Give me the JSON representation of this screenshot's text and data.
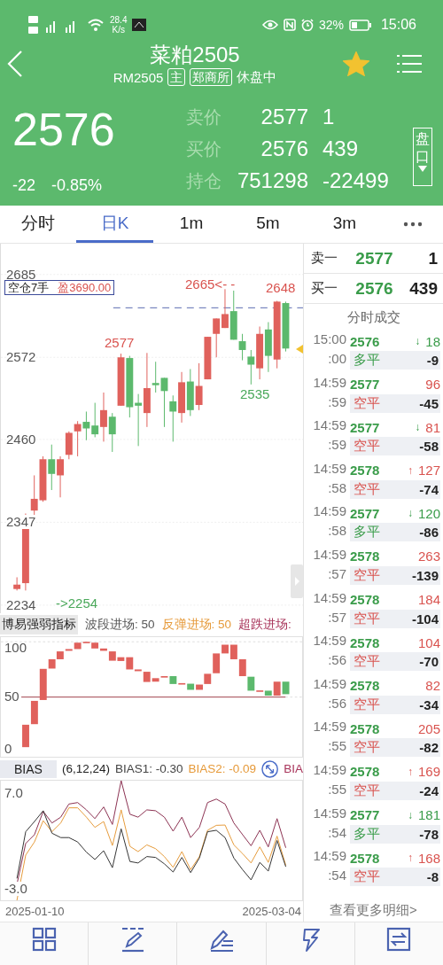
{
  "status_bar": {
    "speed": "28.4",
    "speed_unit": "K/s",
    "battery": "32%",
    "time": "15:06"
  },
  "header": {
    "title": "菜粕2505",
    "code": "RM2505",
    "tags": [
      "主",
      "郑商所"
    ],
    "state": "休盘中",
    "favorite": true
  },
  "quote": {
    "price": "2576",
    "change": "-22",
    "change_pct": "-0.85%",
    "depth_button": "盘口",
    "rows": [
      {
        "label": "卖价",
        "value": "2577",
        "extra": "1"
      },
      {
        "label": "买价",
        "value": "2576",
        "extra": "439"
      },
      {
        "label": "持仓",
        "value": "751298",
        "extra": "-22499"
      }
    ]
  },
  "tabs": [
    {
      "label": "分时",
      "selected": false
    },
    {
      "label": "日K",
      "selected": true
    },
    {
      "label": "1m",
      "selected": false
    },
    {
      "label": "5m",
      "selected": false
    },
    {
      "label": "3m",
      "selected": false
    }
  ],
  "chart": {
    "chart_data": {
      "type": "candlestick",
      "ylim": [
        2223,
        2727
      ],
      "ohlc": [
        [
          2256,
          2272,
          2254,
          2262
        ],
        [
          2264,
          2359,
          2254,
          2355
        ],
        [
          2363,
          2411,
          2357,
          2379
        ],
        [
          2377,
          2437,
          2375,
          2433
        ],
        [
          2433,
          2453,
          2391,
          2413
        ],
        [
          2411,
          2437,
          2381,
          2433
        ],
        [
          2439,
          2471,
          2433,
          2469
        ],
        [
          2471,
          2485,
          2437,
          2481
        ],
        [
          2484,
          2498,
          2459,
          2475
        ],
        [
          2479,
          2510,
          2463,
          2467
        ],
        [
          2477,
          2524,
          2457,
          2500
        ],
        [
          2491,
          2496,
          2443,
          2467
        ],
        [
          2506,
          2577,
          2506,
          2572
        ],
        [
          2571,
          2574,
          2490,
          2504
        ],
        [
          2510,
          2522,
          2451,
          2506
        ],
        [
          2496,
          2578,
          2477,
          2530
        ],
        [
          2537,
          2566,
          2524,
          2534
        ],
        [
          2544,
          2544,
          2477,
          2526
        ],
        [
          2512,
          2520,
          2457,
          2498
        ],
        [
          2496,
          2552,
          2483,
          2538
        ],
        [
          2539,
          2556,
          2492,
          2500
        ],
        [
          2507,
          2564,
          2500,
          2533
        ],
        [
          2542,
          2600,
          2542,
          2600
        ],
        [
          2604,
          2625,
          2572,
          2625
        ],
        [
          2612,
          2665,
          2612,
          2631
        ],
        [
          2635,
          2663,
          2596,
          2596
        ],
        [
          2594,
          2604,
          2568,
          2582
        ],
        [
          2573,
          2582,
          2535,
          2562
        ],
        [
          2557,
          2614,
          2542,
          2604
        ],
        [
          2610,
          2620,
          2552,
          2574
        ],
        [
          2569,
          2649,
          2557,
          2648
        ],
        [
          2646,
          2648,
          2580,
          2584
        ]
      ],
      "yticks": [
        2685,
        2572,
        2460,
        2347,
        2234
      ],
      "grid": true
    },
    "position": {
      "label": "空仓7手",
      "profit": "盈3690.00"
    },
    "annotations": [
      {
        "text": "2665<- -",
        "kind": "high"
      },
      {
        "text": "2648",
        "kind": "high"
      },
      {
        "text": "2577",
        "kind": "high"
      },
      {
        "text": "2535",
        "kind": "low"
      },
      {
        "text": "->2254",
        "kind": "low"
      }
    ]
  },
  "indicator": {
    "name": "博易强弱指标",
    "params": [
      {
        "text": "波段进场: 50",
        "kind": "wave"
      },
      {
        "text": "反弹进场: 50",
        "kind": "rebound"
      },
      {
        "text": "超跌进场:",
        "kind": "oversold"
      }
    ],
    "y_labels": [
      "100",
      "50",
      "0"
    ]
  },
  "bias": {
    "name": "BIAS",
    "params": "(6,12,24)",
    "values": [
      {
        "text": "BIAS1: -0.30",
        "kind": "bias1"
      },
      {
        "text": "BIAS2: -0.09",
        "kind": "bias2"
      },
      {
        "text": "BIA",
        "kind": "bias3"
      }
    ],
    "y_labels": [
      "7.0",
      "-3.0"
    ]
  },
  "dates": [
    "2025-01-10",
    "2025-03-04"
  ],
  "order_book": [
    {
      "label": "卖一",
      "price": "2577",
      "volume": "1"
    },
    {
      "label": "买一",
      "price": "2576",
      "volume": "439"
    }
  ],
  "trades_title": "分时成交",
  "trades": [
    {
      "time": "15:00",
      "second": ":00",
      "price": "2576",
      "arrow": "↓",
      "arrow_up": false,
      "volume": "18",
      "volume_up": false,
      "type": "多平",
      "kind": "long",
      "change": "-9"
    },
    {
      "time": "14:59",
      "second": ":59",
      "price": "2577",
      "volume": "96",
      "volume_up": true,
      "type": "空平",
      "kind": "short",
      "change": "-45"
    },
    {
      "time": "14:59",
      "second": ":59",
      "price": "2577",
      "arrow": "↓",
      "arrow_up": false,
      "volume": "81",
      "volume_up": true,
      "type": "空平",
      "kind": "short",
      "change": "-58"
    },
    {
      "time": "14:59",
      "second": ":58",
      "price": "2578",
      "arrow": "↑",
      "arrow_up": true,
      "volume": "127",
      "volume_up": true,
      "type": "空平",
      "kind": "short",
      "change": "-74"
    },
    {
      "time": "14:59",
      "second": ":58",
      "price": "2577",
      "arrow": "↓",
      "arrow_up": false,
      "volume": "120",
      "volume_up": false,
      "type": "多平",
      "kind": "long",
      "change": "-86"
    },
    {
      "time": "14:59",
      "second": ":57",
      "price": "2578",
      "volume": "263",
      "volume_up": true,
      "type": "空平",
      "kind": "short",
      "change": "-139"
    },
    {
      "time": "14:59",
      "second": ":57",
      "price": "2578",
      "volume": "184",
      "volume_up": true,
      "type": "空平",
      "kind": "short",
      "change": "-104"
    },
    {
      "time": "14:59",
      "second": ":56",
      "price": "2578",
      "volume": "104",
      "volume_up": true,
      "type": "空平",
      "kind": "short",
      "change": "-70"
    },
    {
      "time": "14:59",
      "second": ":56",
      "price": "2578",
      "volume": "82",
      "volume_up": true,
      "type": "空平",
      "kind": "short",
      "change": "-34"
    },
    {
      "time": "14:59",
      "second": ":55",
      "price": "2578",
      "volume": "205",
      "volume_up": true,
      "type": "空平",
      "kind": "short",
      "change": "-82"
    },
    {
      "time": "14:59",
      "second": ":55",
      "price": "2578",
      "arrow": "↑",
      "arrow_up": true,
      "volume": "169",
      "volume_up": true,
      "type": "空平",
      "kind": "short",
      "change": "-24"
    },
    {
      "time": "14:59",
      "second": ":54",
      "price": "2577",
      "arrow": "↓",
      "arrow_up": false,
      "volume": "181",
      "volume_up": false,
      "type": "多平",
      "kind": "long",
      "change": "-78"
    },
    {
      "time": "14:59",
      "second": ":54",
      "price": "2578",
      "arrow": "↑",
      "arrow_up": true,
      "volume": "168",
      "volume_up": true,
      "type": "空平",
      "kind": "short",
      "change": "-8"
    }
  ],
  "more_link": "查看更多明细>",
  "toolbar": [
    {
      "kind": "grid"
    },
    {
      "kind": "draw"
    },
    {
      "kind": "draw-lines"
    },
    {
      "kind": "flash"
    },
    {
      "kind": "switch"
    }
  ]
}
